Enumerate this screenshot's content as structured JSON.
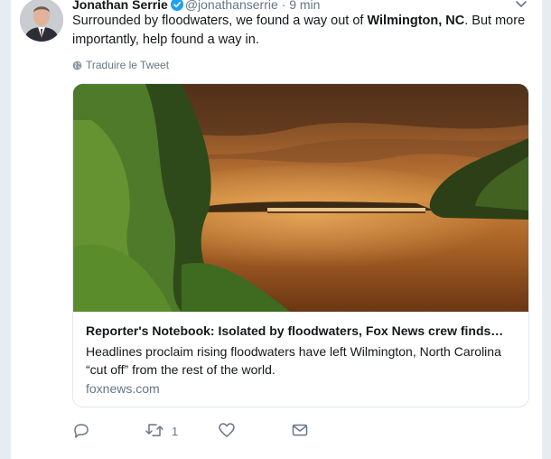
{
  "tweet": {
    "author_name": "Jonathan Serrie",
    "handle": "@jonathanserrie",
    "separator": "·",
    "time": "9 min",
    "text_part1": "Surrounded by floodwaters, we found a way out of ",
    "text_bold": "Wilmington, NC",
    "text_part2": ". But more importantly, help found a way in.",
    "translate_label": "Traduire le Tweet"
  },
  "card": {
    "title": "Reporter's Notebook: Isolated by floodwaters, Fox News crew finds…",
    "description": "Headlines proclaim rising floodwaters have left Wilmington, North Carolina “cut off” from the rest of the world.",
    "domain": "foxnews.com"
  },
  "actions": {
    "reply_count": "",
    "retweet_count": "1",
    "like_count": "",
    "dm_count": ""
  },
  "icons": {
    "verified": "verified-badge-icon",
    "caret": "chevron-down-icon",
    "globe": "globe-icon",
    "reply": "reply-icon",
    "retweet": "retweet-icon",
    "like": "heart-icon",
    "message": "envelope-icon"
  },
  "colors": {
    "verified_blue": "#1da1f2",
    "secondary_text": "#657786",
    "border": "#e1e8ed",
    "background": "#e6ecf0"
  }
}
